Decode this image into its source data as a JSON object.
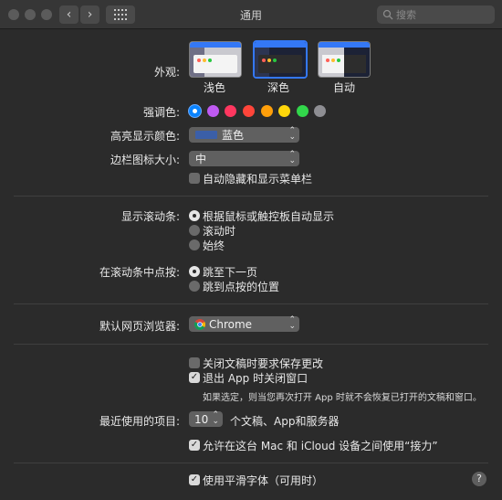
{
  "window": {
    "title": "通用"
  },
  "search": {
    "placeholder": "搜索"
  },
  "appearance": {
    "label": "外观:",
    "options": [
      "浅色",
      "深色",
      "自动"
    ],
    "selected": "深色"
  },
  "accent": {
    "label": "强调色:",
    "colors": [
      "#0a84ff",
      "#bf5af2",
      "#ff375f",
      "#ff453a",
      "#ff9f0a",
      "#ffd60a",
      "#32d74b",
      "#8e8e93"
    ],
    "selected": "#0a84ff"
  },
  "highlight": {
    "label": "高亮显示颜色:",
    "value": "蓝色",
    "swatch": "#3b5fa8"
  },
  "sidebar": {
    "label": "边栏图标大小:",
    "value": "中"
  },
  "menubar": {
    "label": "自动隐藏和显示菜单栏",
    "checked": false
  },
  "scrollbars": {
    "label": "显示滚动条:",
    "options": [
      "根据鼠标或触控板自动显示",
      "滚动时",
      "始终"
    ],
    "selected": "根据鼠标或触控板自动显示"
  },
  "click_scroll": {
    "label": "在滚动条中点按:",
    "options": [
      "跳至下一页",
      "跳到点按的位置"
    ],
    "selected": "跳至下一页"
  },
  "browser": {
    "label": "默认网页浏览器:",
    "value": "Chrome"
  },
  "documents": {
    "ask_save": {
      "label": "关闭文稿时要求保存更改",
      "checked": false
    },
    "close_windows": {
      "label": "退出 App 时关闭窗口",
      "checked": true
    },
    "note": "如果选定，则当您再次打开 App 时就不会恢复已打开的文稿和窗口。"
  },
  "recent": {
    "label": "最近使用的项目:",
    "value": "10",
    "suffix": "个文稿、App和服务器"
  },
  "handoff": {
    "label": "允许在这台 Mac 和 iCloud 设备之间使用“接力”",
    "checked": true
  },
  "font_smoothing": {
    "label": "使用平滑字体（可用时）",
    "checked": true
  },
  "help": {
    "label": "?"
  }
}
